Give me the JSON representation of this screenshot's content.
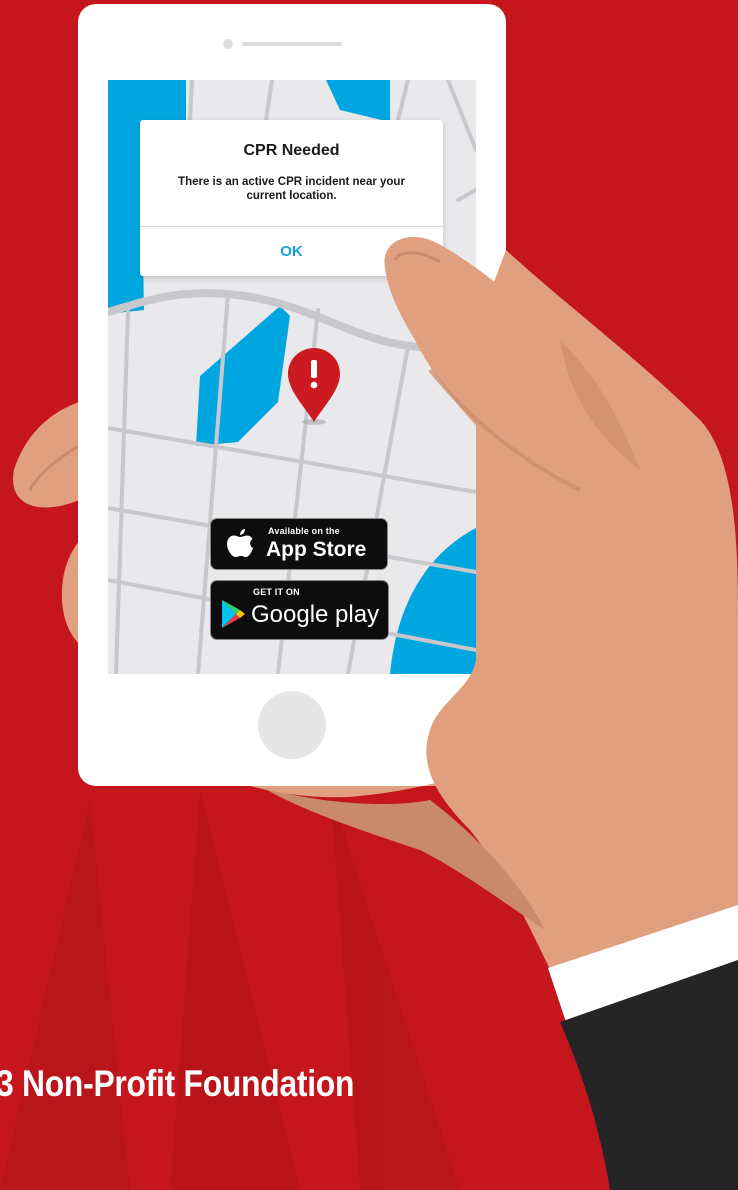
{
  "alert": {
    "title": "CPR Needed",
    "message": "There is an active CPR incident near your current location.",
    "ok_label": "OK"
  },
  "badges": {
    "app_store": {
      "small": "Available on the",
      "big": "App Store"
    },
    "google_play": {
      "small": "GET IT ON",
      "big": "Google play"
    }
  },
  "footer": {
    "text": "3 Non-Profit Foundation"
  },
  "colors": {
    "background": "#c4161c",
    "skin": "#e0a07f",
    "skin_shadow": "#c98a6b",
    "water": "#00a6e0",
    "map_land": "#e9e9eb",
    "road": "#c7c7cc",
    "pin": "#cc1a22",
    "link": "#1a9fd6"
  },
  "icons": {
    "map_pin": "alert-pin-icon",
    "apple": "apple-logo-icon",
    "google_play": "google-play-logo-icon"
  }
}
